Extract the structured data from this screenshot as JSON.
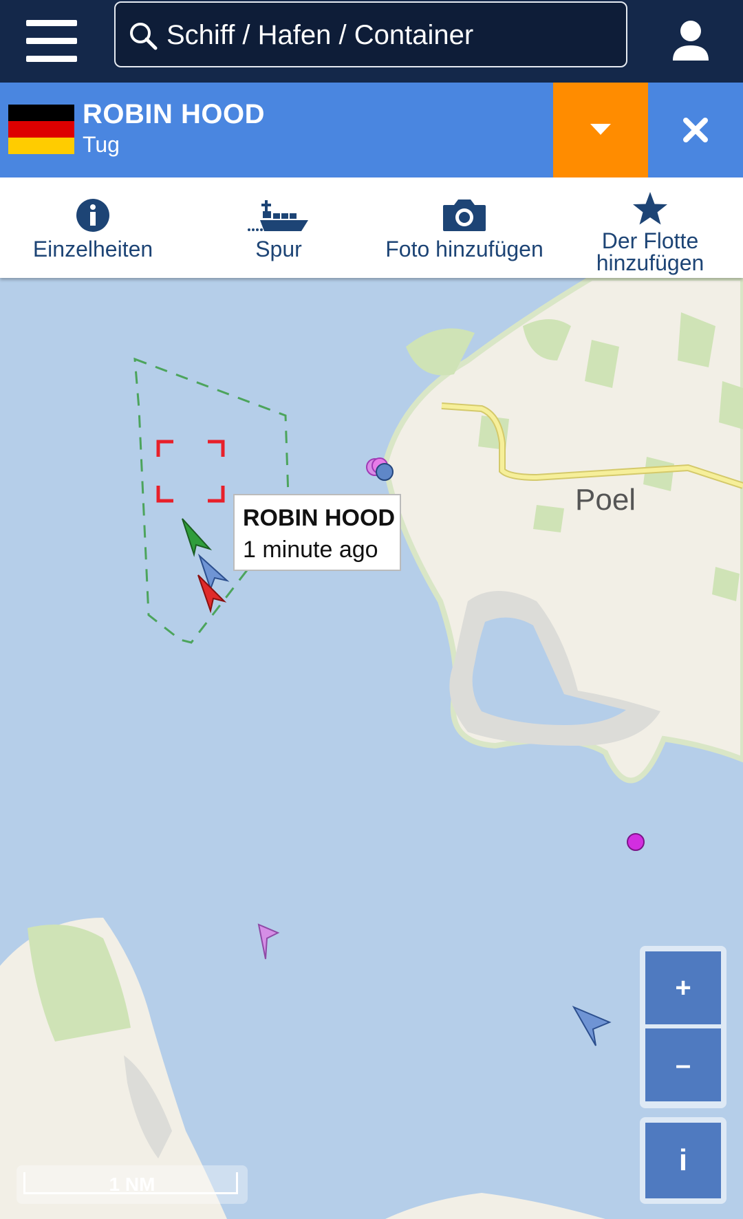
{
  "header": {
    "search_placeholder": "Schiff / Hafen / Container",
    "menu_icon": "hamburger-menu-icon",
    "user_icon": "user-icon"
  },
  "vessel": {
    "name": "ROBIN HOOD",
    "type": "Tug",
    "flag": "germany-flag",
    "flag_colors": [
      "#000000",
      "#dd0000",
      "#ffcc00"
    ],
    "dropdown_color": "#ff8c00",
    "bar_color": "#4a86e0"
  },
  "actions": [
    {
      "label": "Einzelheiten",
      "icon": "info-icon"
    },
    {
      "label": "Spur",
      "icon": "ship-track-icon"
    },
    {
      "label": "Foto hinzufügen",
      "icon": "camera-icon"
    },
    {
      "label": "Der Flotte hinzufügen",
      "icon": "star-icon"
    }
  ],
  "map": {
    "tooltip": {
      "name": "ROBIN HOOD",
      "time": "1 minute ago"
    },
    "place_label": "Poel",
    "zoom_in": "+",
    "zoom_out": "–",
    "info": "i",
    "scale": "1 NM",
    "colors": {
      "water": "#b5cee9",
      "land": "#f2efe6",
      "green": "#cfe3b6",
      "road": "#f6ef9a"
    }
  }
}
